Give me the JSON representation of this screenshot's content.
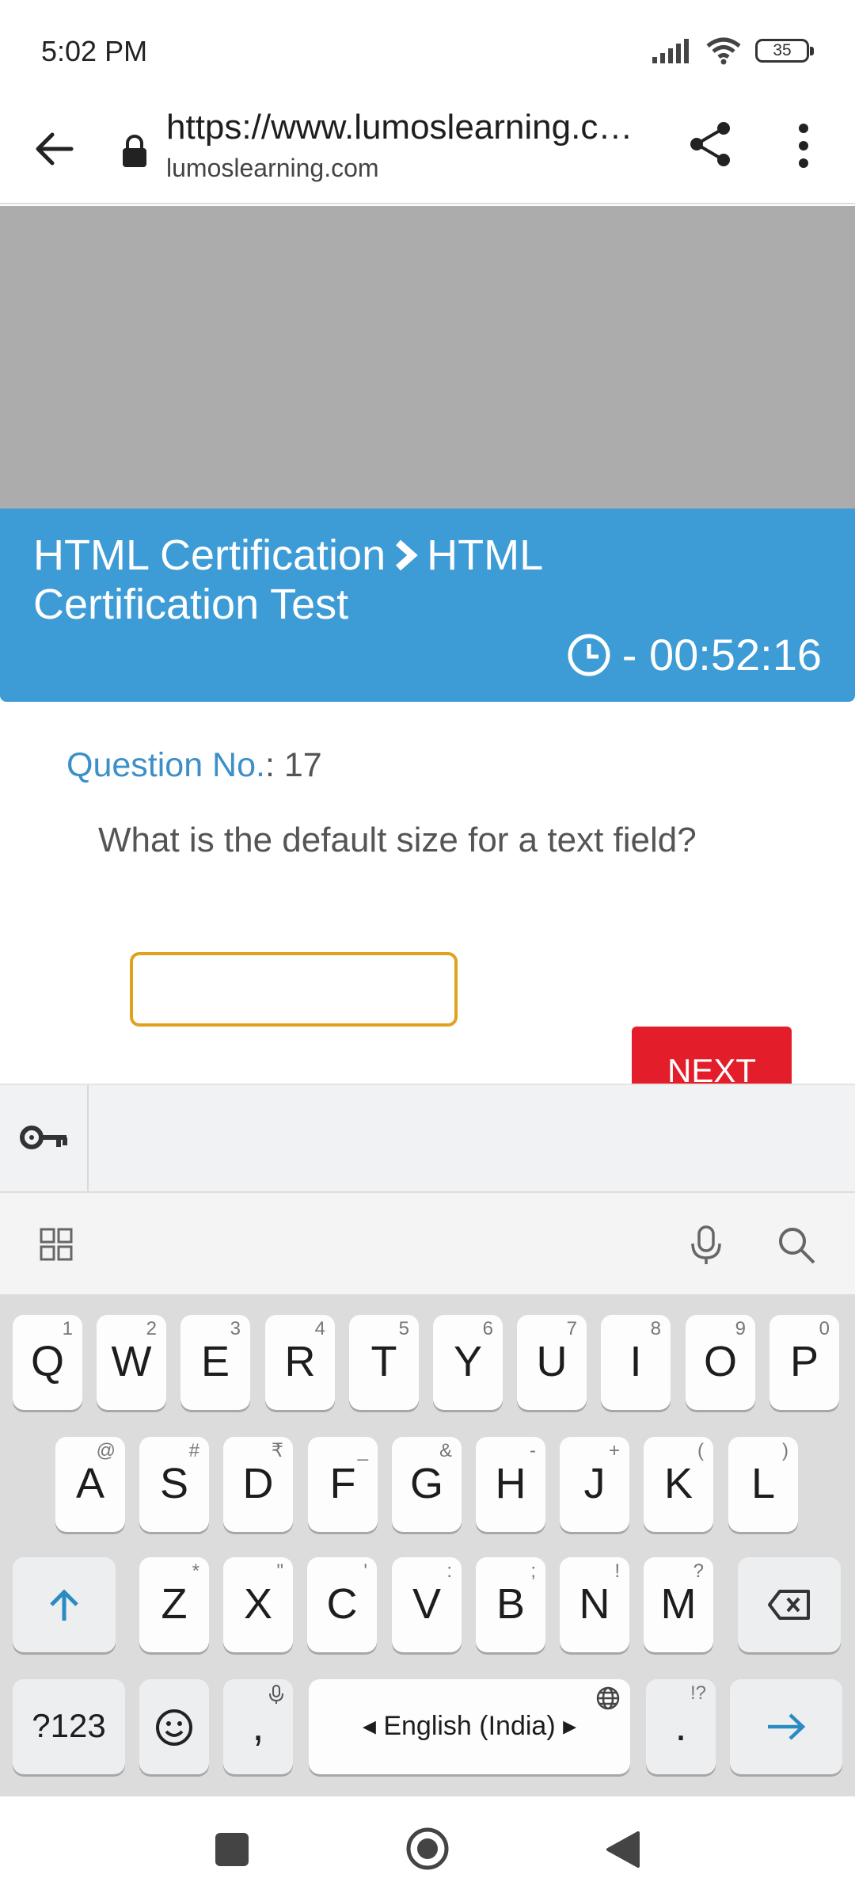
{
  "status_bar": {
    "time": "5:02 PM",
    "battery": "35"
  },
  "browser": {
    "url": "https://www.lumoslearning.com/llwp/html-certification-test",
    "domain": "lumoslearning.com"
  },
  "banner": {
    "crumb_first": "HTML Certification",
    "crumb_second": "HTML Certification Test",
    "timer": "- 00:52:16"
  },
  "question": {
    "label": "Question No.",
    "number": ": 17",
    "text": "What is the default size for a text field?",
    "answer_value": ""
  },
  "next_button": "NEXT",
  "keyboard": {
    "row1": [
      {
        "k": "Q",
        "h": "1"
      },
      {
        "k": "W",
        "h": "2"
      },
      {
        "k": "E",
        "h": "3"
      },
      {
        "k": "R",
        "h": "4"
      },
      {
        "k": "T",
        "h": "5"
      },
      {
        "k": "Y",
        "h": "6"
      },
      {
        "k": "U",
        "h": "7"
      },
      {
        "k": "I",
        "h": "8"
      },
      {
        "k": "O",
        "h": "9"
      },
      {
        "k": "P",
        "h": "0"
      }
    ],
    "row2": [
      {
        "k": "A",
        "h": "@"
      },
      {
        "k": "S",
        "h": "#"
      },
      {
        "k": "D",
        "h": "₹"
      },
      {
        "k": "F",
        "h": "_"
      },
      {
        "k": "G",
        "h": "&"
      },
      {
        "k": "H",
        "h": "-"
      },
      {
        "k": "J",
        "h": "+"
      },
      {
        "k": "K",
        "h": "("
      },
      {
        "k": "L",
        "h": ")"
      }
    ],
    "row3": [
      {
        "k": "Z",
        "h": "*"
      },
      {
        "k": "X",
        "h": "\""
      },
      {
        "k": "C",
        "h": "'"
      },
      {
        "k": "V",
        "h": ":"
      },
      {
        "k": "B",
        "h": ";"
      },
      {
        "k": "N",
        "h": "!"
      },
      {
        "k": "M",
        "h": "?"
      }
    ],
    "symbols_key": "?123",
    "comma_key": ",",
    "space_label": "English (India)",
    "period_key": ".",
    "period_hint": "!?"
  }
}
